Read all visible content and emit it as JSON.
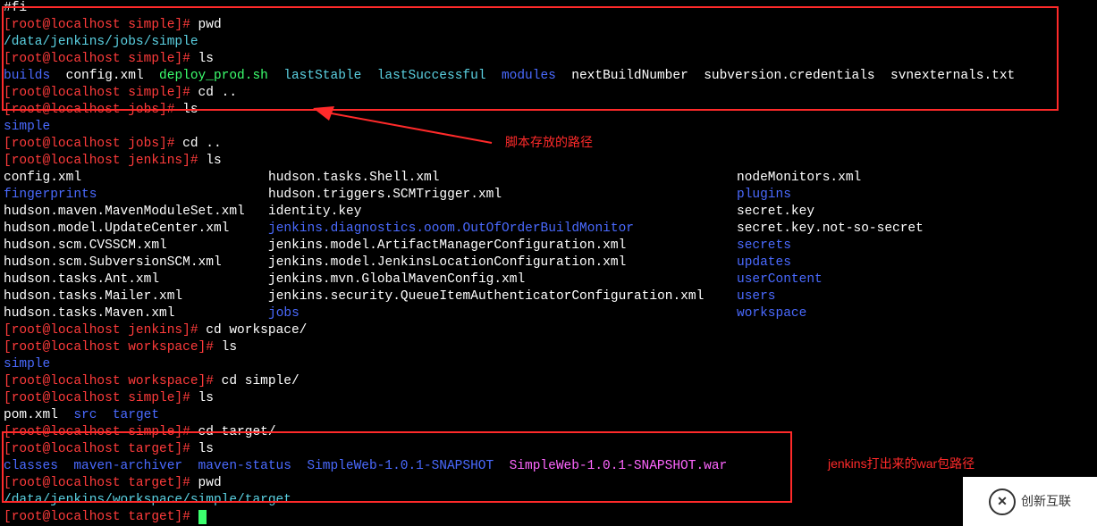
{
  "annotations": {
    "arrow_label": "脚本存放的路径",
    "war_label": "jenkins打出来的war包路径"
  },
  "logo": {
    "text": "创新互联",
    "symbol": "✕"
  },
  "lines": [
    {
      "spans": [
        {
          "t": "#fi",
          "c": "txt-white"
        }
      ]
    },
    {
      "spans": [
        {
          "t": "[root@localhost simple]# ",
          "c": "prompt-red"
        },
        {
          "t": "pwd",
          "c": "txt-white"
        }
      ]
    },
    {
      "spans": [
        {
          "t": "/data/jenkins/jobs/simple",
          "c": "txt-teal"
        }
      ]
    },
    {
      "spans": [
        {
          "t": "[root@localhost simple]# ",
          "c": "prompt-red"
        },
        {
          "t": "ls",
          "c": "txt-white"
        }
      ]
    },
    {
      "spans": [
        {
          "t": "builds",
          "c": "txt-blue"
        },
        {
          "t": "  ",
          "c": "txt-white"
        },
        {
          "t": "config.xml  ",
          "c": "txt-white"
        },
        {
          "t": "deploy_prod.sh",
          "c": "txt-green"
        },
        {
          "t": "  ",
          "c": "txt-white"
        },
        {
          "t": "lastStable  lastSuccessful",
          "c": "txt-teal"
        },
        {
          "t": "  ",
          "c": "txt-white"
        },
        {
          "t": "modules",
          "c": "txt-blue"
        },
        {
          "t": "  ",
          "c": "txt-white"
        },
        {
          "t": "nextBuildNumber  subversion.credentials  svnexternals.txt",
          "c": "txt-white"
        }
      ]
    },
    {
      "spans": [
        {
          "t": "[root@localhost simple]# ",
          "c": "prompt-red"
        },
        {
          "t": "cd ..",
          "c": "txt-white"
        }
      ]
    },
    {
      "spans": [
        {
          "t": "[root@localhost jobs]# ",
          "c": "prompt-red"
        },
        {
          "t": "ls",
          "c": "txt-white"
        }
      ]
    },
    {
      "spans": [
        {
          "t": "simple",
          "c": "txt-blue"
        }
      ]
    },
    {
      "spans": [
        {
          "t": "[root@localhost jobs]# ",
          "c": "prompt-red"
        },
        {
          "t": "cd ..",
          "c": "txt-white"
        }
      ]
    },
    {
      "spans": [
        {
          "t": "[root@localhost jenkins]# ",
          "c": "prompt-red"
        },
        {
          "t": "ls",
          "c": "txt-white"
        }
      ]
    },
    {
      "cols": [
        {
          "t": "config.xml",
          "c": "txt-white"
        },
        {
          "t": "hudson.tasks.Shell.xml",
          "c": "txt-white"
        },
        {
          "t": "nodeMonitors.xml",
          "c": "txt-white"
        }
      ]
    },
    {
      "cols": [
        {
          "t": "fingerprints",
          "c": "txt-blue"
        },
        {
          "t": "hudson.triggers.SCMTrigger.xml",
          "c": "txt-white"
        },
        {
          "t": "plugins",
          "c": "txt-blue"
        }
      ]
    },
    {
      "cols": [
        {
          "t": "hudson.maven.MavenModuleSet.xml",
          "c": "txt-white"
        },
        {
          "t": "identity.key",
          "c": "txt-white"
        },
        {
          "t": "secret.key",
          "c": "txt-white"
        }
      ]
    },
    {
      "cols": [
        {
          "t": "hudson.model.UpdateCenter.xml",
          "c": "txt-white"
        },
        {
          "t": "jenkins.diagnostics.ooom.OutOfOrderBuildMonitor",
          "c": "txt-blue"
        },
        {
          "t": "secret.key.not-so-secret",
          "c": "txt-white"
        }
      ]
    },
    {
      "cols": [
        {
          "t": "hudson.scm.CVSSCM.xml",
          "c": "txt-white"
        },
        {
          "t": "jenkins.model.ArtifactManagerConfiguration.xml",
          "c": "txt-white"
        },
        {
          "t": "secrets",
          "c": "txt-blue"
        }
      ]
    },
    {
      "cols": [
        {
          "t": "hudson.scm.SubversionSCM.xml",
          "c": "txt-white"
        },
        {
          "t": "jenkins.model.JenkinsLocationConfiguration.xml",
          "c": "txt-white"
        },
        {
          "t": "updates",
          "c": "txt-blue"
        }
      ]
    },
    {
      "cols": [
        {
          "t": "hudson.tasks.Ant.xml",
          "c": "txt-white"
        },
        {
          "t": "jenkins.mvn.GlobalMavenConfig.xml",
          "c": "txt-white"
        },
        {
          "t": "userContent",
          "c": "txt-blue"
        }
      ]
    },
    {
      "cols": [
        {
          "t": "hudson.tasks.Mailer.xml",
          "c": "txt-white"
        },
        {
          "t": "jenkins.security.QueueItemAuthenticatorConfiguration.xml",
          "c": "txt-white"
        },
        {
          "t": "users",
          "c": "txt-blue"
        }
      ]
    },
    {
      "cols": [
        {
          "t": "hudson.tasks.Maven.xml",
          "c": "txt-white"
        },
        {
          "t": "jobs",
          "c": "txt-blue"
        },
        {
          "t": "workspace",
          "c": "txt-blue"
        }
      ]
    },
    {
      "spans": [
        {
          "t": "[root@localhost jenkins]# ",
          "c": "prompt-red"
        },
        {
          "t": "cd workspace/",
          "c": "txt-white"
        }
      ]
    },
    {
      "spans": [
        {
          "t": "[root@localhost workspace]# ",
          "c": "prompt-red"
        },
        {
          "t": "ls",
          "c": "txt-white"
        }
      ]
    },
    {
      "spans": [
        {
          "t": "simple",
          "c": "txt-blue"
        }
      ]
    },
    {
      "spans": [
        {
          "t": "[root@localhost workspace]# ",
          "c": "prompt-red"
        },
        {
          "t": "cd simple/",
          "c": "txt-white"
        }
      ]
    },
    {
      "spans": [
        {
          "t": "[root@localhost simple]# ",
          "c": "prompt-red"
        },
        {
          "t": "ls",
          "c": "txt-white"
        }
      ]
    },
    {
      "spans": [
        {
          "t": "pom.xml  ",
          "c": "txt-white"
        },
        {
          "t": "src  target",
          "c": "txt-blue"
        }
      ]
    },
    {
      "spans": [
        {
          "t": "[root@localhost simple]# ",
          "c": "prompt-red"
        },
        {
          "t": "cd target/",
          "c": "txt-white"
        }
      ]
    },
    {
      "spans": [
        {
          "t": "[root@localhost target]# ",
          "c": "prompt-red"
        },
        {
          "t": "ls",
          "c": "txt-white"
        }
      ]
    },
    {
      "spans": [
        {
          "t": "classes  maven-archiver  maven-status  SimpleWeb-1.0.1-SNAPSHOT",
          "c": "txt-blue"
        },
        {
          "t": "  ",
          "c": "txt-white"
        },
        {
          "t": "SimpleWeb-1.0.1-SNAPSHOT.war",
          "c": "txt-pink"
        }
      ]
    },
    {
      "spans": [
        {
          "t": "[root@localhost target]# ",
          "c": "prompt-red"
        },
        {
          "t": "pwd",
          "c": "txt-white"
        }
      ]
    },
    {
      "spans": [
        {
          "t": "/data/jenkins/workspace/simple/target",
          "c": "txt-teal"
        }
      ]
    },
    {
      "spans": [
        {
          "t": "[root@localhost target]# ",
          "c": "prompt-red"
        }
      ],
      "cursor": true
    }
  ]
}
